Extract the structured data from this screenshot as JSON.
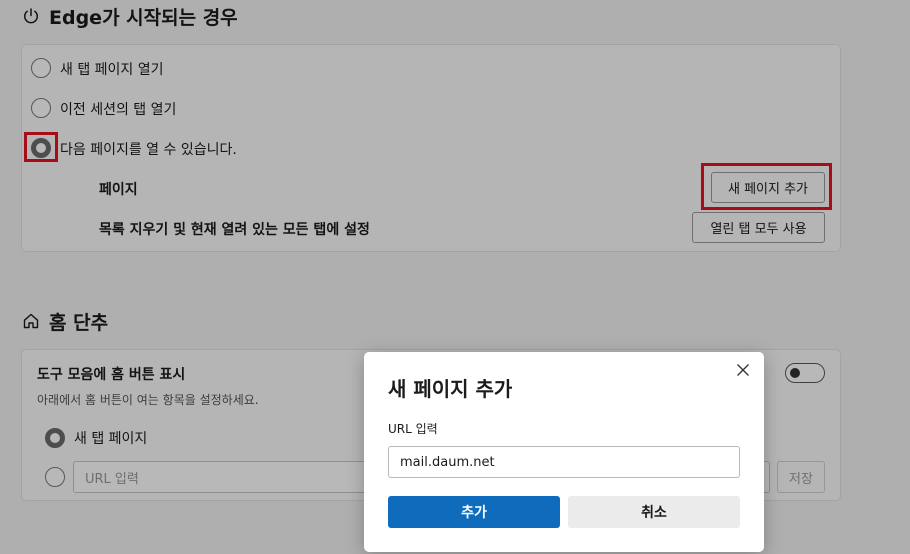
{
  "startup": {
    "title": "Edge가 시작되는 경우",
    "options": [
      {
        "label": "새 탭 페이지 열기",
        "selected": false
      },
      {
        "label": "이전 세션의 탭 열기",
        "selected": false
      },
      {
        "label": "다음 페이지를 열 수 있습니다.",
        "selected": true
      }
    ],
    "pages_label": "페이지",
    "add_page_button": "새 페이지 추가",
    "clear_label": "목록 지우기 및 현재 열려 있는 모든 탭에 설정",
    "use_open_tabs_button": "열린 탭 모두 사용"
  },
  "home": {
    "title": "홈 단추",
    "show_home_label": "도구 모음에 홈 버튼 표시",
    "description": "아래에서 홈 버튼이 여는 항목을 설정하세요.",
    "toggle_on": true,
    "option_new_tab": "새 탭 페이지",
    "url_placeholder": "URL 입력",
    "save_button": "저장"
  },
  "dialog": {
    "title": "새 페이지 추가",
    "url_label": "URL 입력",
    "url_value": "mail.daum.net",
    "add_button": "추가",
    "cancel_button": "취소"
  },
  "colors": {
    "primary": "#0f6cbd",
    "highlight": "#e81123"
  },
  "icons": {
    "startup": "power-icon",
    "home": "home-icon",
    "close": "close-icon"
  }
}
